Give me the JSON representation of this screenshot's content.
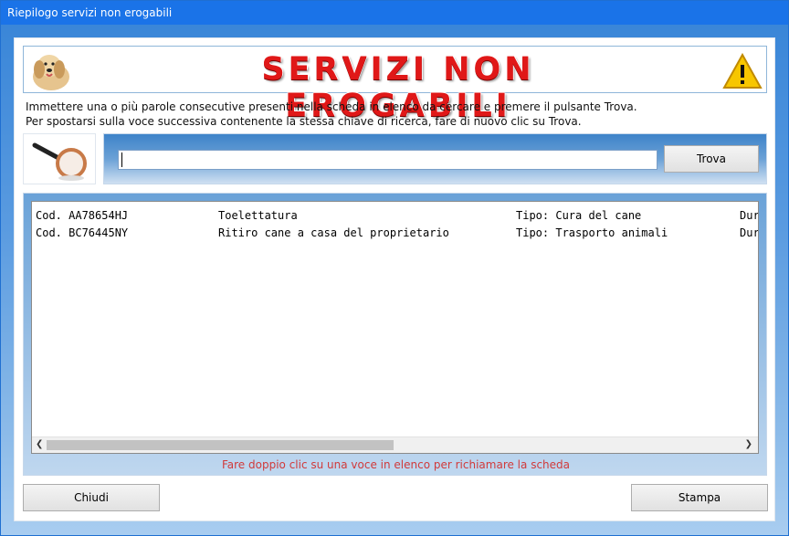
{
  "window": {
    "title": "Riepilogo servizi non erogabili"
  },
  "banner": {
    "title": "SERVIZI NON EROGABILI",
    "left_icon": "dog-icon",
    "right_icon": "warning-icon"
  },
  "instructions": {
    "line1": "Immettere una o più parole consecutive presenti nella scheda in elenco da cercare e premere il pulsante Trova.",
    "line2": "Per spostarsi sulla voce successiva contenente la stessa chiave di ricerca, fare di nuovo clic su Trova."
  },
  "search": {
    "value": "",
    "icon": "magnifier-icon",
    "button_label": "Trova"
  },
  "list": {
    "rows": [
      {
        "code": "Cod. AA78654HJ",
        "name": "Toelettatura",
        "type": "Tipo: Cura del cane",
        "extra": "Dur"
      },
      {
        "code": "Cod. BC76445NY",
        "name": "Ritiro cane a casa del proprietario",
        "type": "Tipo: Trasporto animali",
        "extra": "Dur"
      }
    ],
    "hint": "Fare doppio clic su una voce in elenco per richiamare la scheda"
  },
  "buttons": {
    "close_label": "Chiudi",
    "print_label": "Stampa"
  },
  "colors": {
    "titlebar": "#1a73e8",
    "banner_text": "#e01818",
    "hint_text": "#d13a3a"
  }
}
